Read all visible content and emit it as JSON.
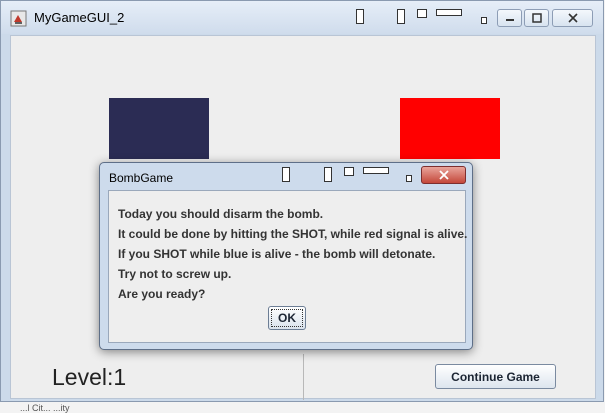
{
  "window": {
    "title": "MyGameGUI_2",
    "icon": "java-cup-icon",
    "level_label": "Level:1",
    "continue_button": "Continue Game",
    "dark_rect_color": "#2b2c54",
    "red_rect_color": "#ff0000"
  },
  "dialog": {
    "title": "BombGame",
    "lines": [
      "Today you should disarm the bomb.",
      "It could be done by hitting the SHOT, while red signal is alive.",
      "If you SHOT while  blue is alive - the bomb will detonate.",
      "Try not to screw up.",
      "Are you ready?"
    ],
    "ok_button": "OK",
    "close_icon": "close-icon"
  },
  "caption_buttons": [
    "minimize-icon",
    "maximize-icon",
    "close-icon"
  ],
  "bottom_text": "...l Cit... ...ity"
}
